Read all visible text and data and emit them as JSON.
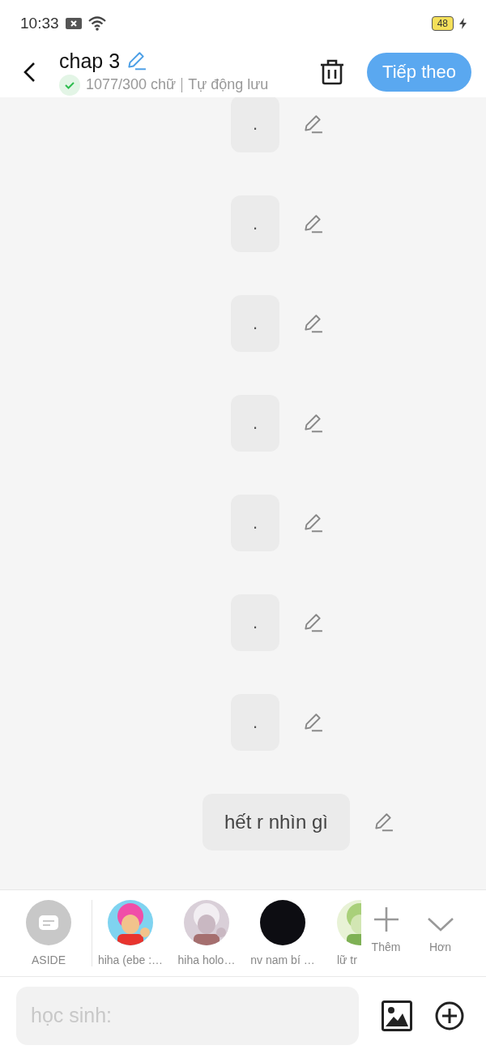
{
  "status_bar": {
    "time": "10:33",
    "battery": "48",
    "charging": true
  },
  "header": {
    "title": "chap 3",
    "word_count": "1077/300 chữ",
    "save_status": "Tự động lưu",
    "saved": true,
    "next_button": "Tiếp theo"
  },
  "messages": [
    {
      "text": "."
    },
    {
      "text": "."
    },
    {
      "text": "."
    },
    {
      "text": "."
    },
    {
      "text": "."
    },
    {
      "text": "."
    },
    {
      "text": "."
    },
    {
      "text": "hết r nhìn gì"
    }
  ],
  "characters": [
    {
      "kind": "aside",
      "label": "ASIDE"
    },
    {
      "kind": "character",
      "label": "hiha (ebe :…"
    },
    {
      "kind": "character",
      "label": "hiha holo…"
    },
    {
      "kind": "blank",
      "label": "nv nam bí …"
    },
    {
      "kind": "character",
      "label": "lữ tr"
    }
  ],
  "character_actions": [
    {
      "kind": "add",
      "label": "Thêm"
    },
    {
      "kind": "more",
      "label": "Hơn"
    }
  ],
  "composer": {
    "placeholder": "học sinh:"
  }
}
